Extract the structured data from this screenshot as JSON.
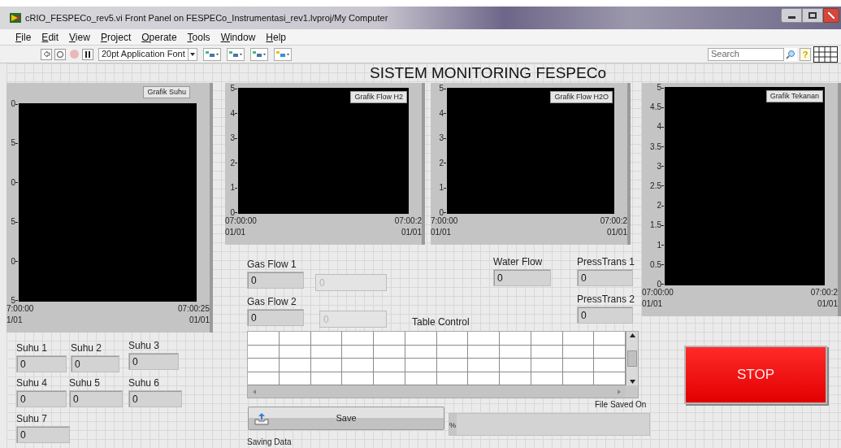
{
  "window": {
    "title": "cRIO_FESPECo_rev5.vi Front Panel on FESPECo_Instrumentasi_rev1.lvproj/My Computer"
  },
  "menu": [
    "File",
    "Edit",
    "View",
    "Project",
    "Operate",
    "Tools",
    "Window",
    "Help"
  ],
  "toolbar": {
    "font": "20pt Application Font",
    "search_placeholder": "Search",
    "help": "?"
  },
  "panel_title": "SISTEM MONITORING FESPECo",
  "charts": [
    {
      "title": "Grafik Suhu",
      "y_ticks": [
        "0",
        "5",
        "0",
        "5",
        "0",
        "5"
      ],
      "x_labels": [
        {
          "time": "7:00:00",
          "date": "1/01"
        },
        {
          "time": "07:00:25",
          "date": "01/01"
        }
      ]
    },
    {
      "title": "Grafik Flow H2",
      "y_ticks": [
        "5",
        "4",
        "3",
        "2",
        "1",
        "0"
      ],
      "x_labels": [
        {
          "time": "07:00:00",
          "date": "01/01"
        },
        {
          "time": "07:00:2",
          "date": "01/01"
        }
      ]
    },
    {
      "title": "Grafik Flow H2O",
      "y_ticks": [
        "5",
        "4",
        "3",
        "2",
        "1",
        "0"
      ],
      "x_labels": [
        {
          "time": "7:00:00",
          "date": "01/01"
        },
        {
          "time": "07:00:2",
          "date": "01/01"
        }
      ]
    },
    {
      "title": "Grafik Tekanan",
      "y_ticks": [
        "5",
        "4.5",
        "4",
        "3.5",
        "3",
        "2.5",
        "2",
        "1.5",
        "1",
        "0.5",
        "0"
      ],
      "x_labels": [
        {
          "time": "07:00:00",
          "date": "01/01"
        },
        {
          "time": "07:00:2",
          "date": "01/01"
        }
      ]
    }
  ],
  "indicators": [
    {
      "label": "Suhu 1",
      "value": "0",
      "disabled": false
    },
    {
      "label": "Suhu 2",
      "value": "0",
      "disabled": false
    },
    {
      "label": "Suhu 3",
      "value": "0",
      "disabled": false
    },
    {
      "label": "Suhu 4",
      "value": "0",
      "disabled": false
    },
    {
      "label": "Suhu 5",
      "value": "0",
      "disabled": false
    },
    {
      "label": "Suhu 6",
      "value": "0",
      "disabled": false
    },
    {
      "label": "Suhu 7",
      "value": "0",
      "disabled": false
    },
    {
      "label": "Gas Flow 1",
      "value": "0",
      "disabled": false
    },
    {
      "value": "0",
      "disabled": true
    },
    {
      "label": "Gas Flow 2",
      "value": "0",
      "disabled": false
    },
    {
      "value": "0",
      "disabled": true
    },
    {
      "label": "Water Flow",
      "value": "0",
      "disabled": false
    },
    {
      "label": "PressTrans 1",
      "value": "0",
      "disabled": false
    },
    {
      "label": "PressTrans 2",
      "value": "0",
      "disabled": false
    }
  ],
  "table": {
    "label": "Table Control"
  },
  "save_button": {
    "label": "Save",
    "caption": "Saving Data"
  },
  "file_path": {
    "label": "File Saved On",
    "prefix": "%"
  },
  "stop_button": {
    "label": "STOP"
  }
}
